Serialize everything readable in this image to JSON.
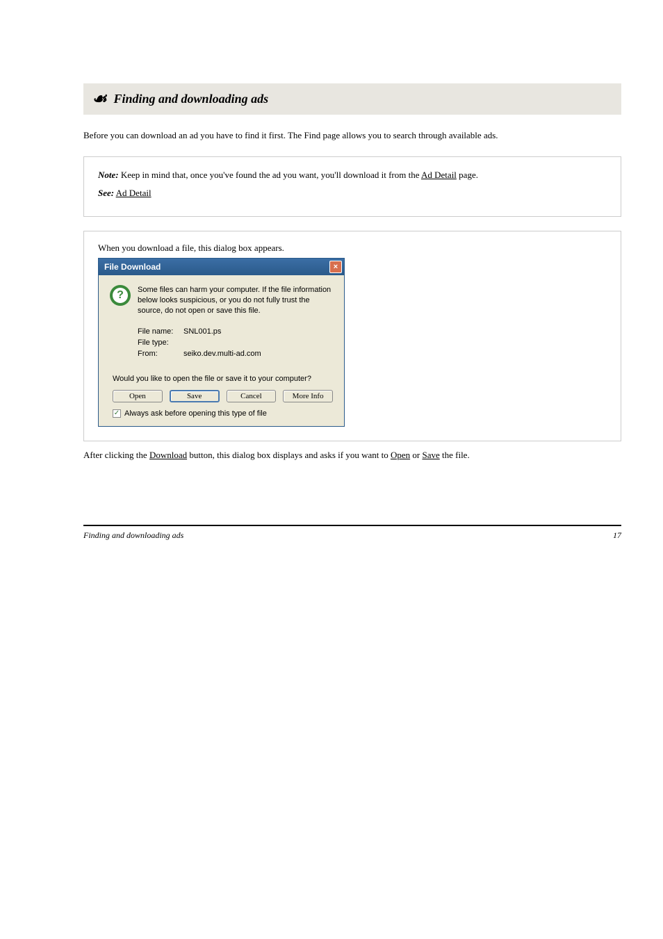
{
  "flourish": "☙",
  "section": {
    "title": "Finding and downloading ads"
  },
  "intro": "Before you can download an ad you have to find it first. The Find page allows you to search through available ads.",
  "note": {
    "label": "Note:",
    "line1a": "Keep in mind that, once you've found the ad you want, you'll download it from the ",
    "line1b": "Ad Detail",
    "line1c": " page.",
    "see_label": "See:",
    "see_link": "Ad Detail"
  },
  "caption": "When you download a file, this dialog box appears.",
  "dialog": {
    "title": "File Download",
    "close": "×",
    "question_mark": "?",
    "warning": "Some files can harm your computer. If the file information below looks suspicious, or you do not fully trust the source, do not open or save this file.",
    "rows": {
      "filename_label": "File name:",
      "filename_value": "SNL001.ps",
      "filetype_label": "File type:",
      "filetype_value": "",
      "from_label": "From:",
      "from_value": "seiko.dev.multi-ad.com"
    },
    "prompt": "Would you like to open the file or save it to your computer?",
    "buttons": {
      "open": "Open",
      "save": "Save",
      "cancel": "Cancel",
      "more": "More Info"
    },
    "checkbox_check": "✓",
    "checkbox_label": "Always ask before opening this type of file"
  },
  "after": {
    "part1": "After clicking the ",
    "u1": "Download",
    "part2": " button, this dialog box displays and asks if you want to ",
    "u2": "Open",
    "part3": " or ",
    "u3": "Save",
    "part4": " the file."
  },
  "footer": {
    "left": "Finding and downloading ads",
    "right": "17"
  }
}
